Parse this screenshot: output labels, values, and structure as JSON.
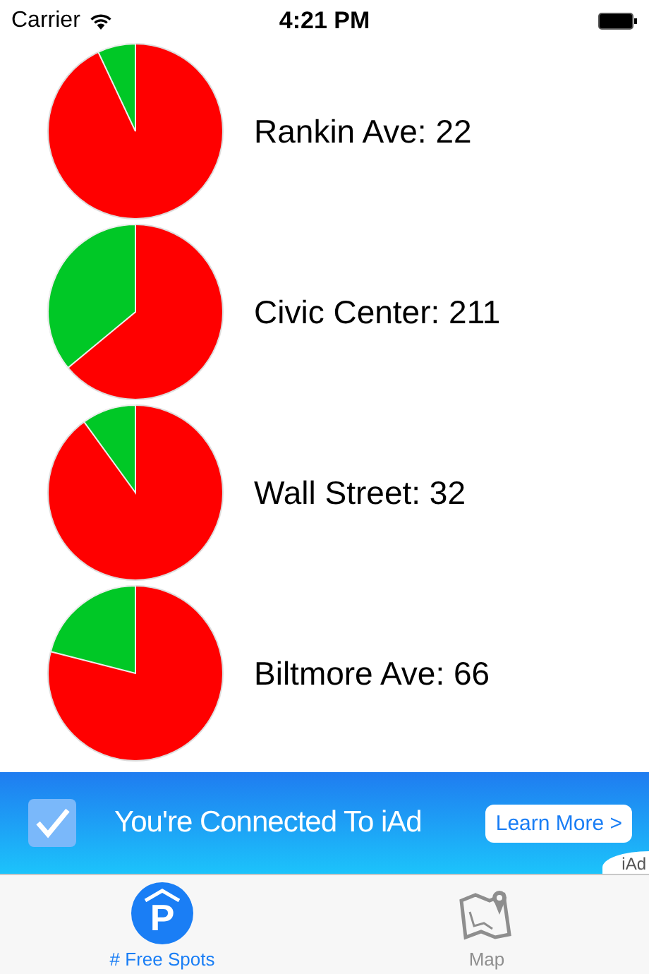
{
  "status_bar": {
    "carrier": "Carrier",
    "time": "4:21 PM"
  },
  "lots": [
    {
      "label": "Rankin Ave: 22"
    },
    {
      "label": "Civic Center: 211"
    },
    {
      "label": "Wall Street: 32"
    },
    {
      "label": "Biltmore Ave: 66"
    }
  ],
  "ad": {
    "text": "You're Connected To iAd",
    "button": "Learn More >",
    "brand": "iAd"
  },
  "tabs": [
    {
      "label": "# Free Spots",
      "kind": "parking",
      "icon_text": "P",
      "selected": true
    },
    {
      "label": "Map",
      "kind": "map",
      "selected": false
    }
  ]
}
